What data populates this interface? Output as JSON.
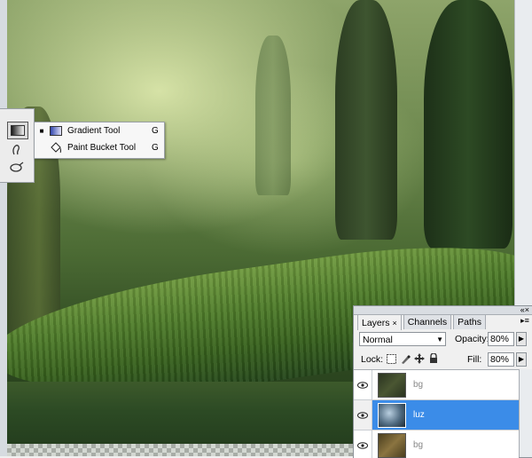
{
  "flyout": {
    "items": [
      {
        "label": "Gradient Tool",
        "shortcut": "G",
        "selected_mark": "■",
        "icon": "gradient-icon"
      },
      {
        "label": "Paint Bucket Tool",
        "shortcut": "G",
        "selected_mark": "",
        "icon": "paint-bucket-icon"
      }
    ]
  },
  "layers_panel": {
    "tabs": [
      {
        "label": "Layers",
        "close": "×",
        "active": true
      },
      {
        "label": "Channels",
        "active": false
      },
      {
        "label": "Paths",
        "active": false
      }
    ],
    "menu_glyph": "«×",
    "options_glyph": "▸≡",
    "blend_mode": "Normal",
    "opacity_label": "Opacity:",
    "opacity_value": "80%",
    "lock_label": "Lock:",
    "fill_label": "Fill:",
    "fill_value": "80%",
    "arrow_glyph": "▶",
    "caret_glyph": "▼",
    "layers": [
      {
        "name": "bg",
        "visible": true,
        "selected": false,
        "thumb_color": "#3a4428"
      },
      {
        "name": "luz",
        "visible": true,
        "selected": true,
        "thumb_color": "#6e8fa8"
      },
      {
        "name": "bg",
        "visible": true,
        "selected": false,
        "thumb_color": "#6b5a2e"
      }
    ]
  },
  "colors": {
    "selection_blue": "#3b8ce8",
    "panel_bg": "#f0f0f0"
  }
}
